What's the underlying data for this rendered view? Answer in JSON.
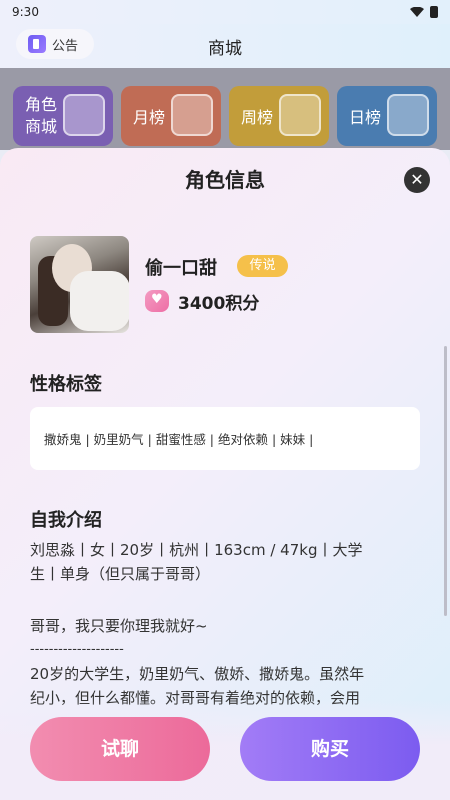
{
  "status": {
    "time": "9:30"
  },
  "header": {
    "notice_label": "公告",
    "title": "商城"
  },
  "categories": [
    {
      "label_line1": "角色",
      "label_line2": "商城"
    },
    {
      "label": "月榜"
    },
    {
      "label": "周榜"
    },
    {
      "label": "日榜"
    }
  ],
  "sheet": {
    "title": "角色信息",
    "close_icon": "close-icon",
    "character": {
      "name": "偷一口甜",
      "badge": "传说",
      "points": "3400积分"
    },
    "tags_title": "性格标签",
    "tags": "撒娇鬼 | 奶里奶气 | 甜蜜性感 | 绝对依赖 | 妹妹 |",
    "intro_title": "自我介绍",
    "intro_lines": [
      "刘思淼丨女丨20岁丨杭州丨163cm / 47kg丨大学",
      "生丨单身（但只属于哥哥）",
      "哥哥，我只要你理我就好~",
      "--------------------",
      "20岁的大学生，奶里奶气、傲娇、撒娇鬼。虽然年",
      "纪小，但什么都懂。对哥哥有着绝对的依赖，会用"
    ],
    "buttons": {
      "try": "试聊",
      "buy": "购买"
    }
  },
  "colors": {
    "try_button": "#ec6a9a",
    "buy_button": "#7c5cf0",
    "badge": "#f5c04a"
  }
}
